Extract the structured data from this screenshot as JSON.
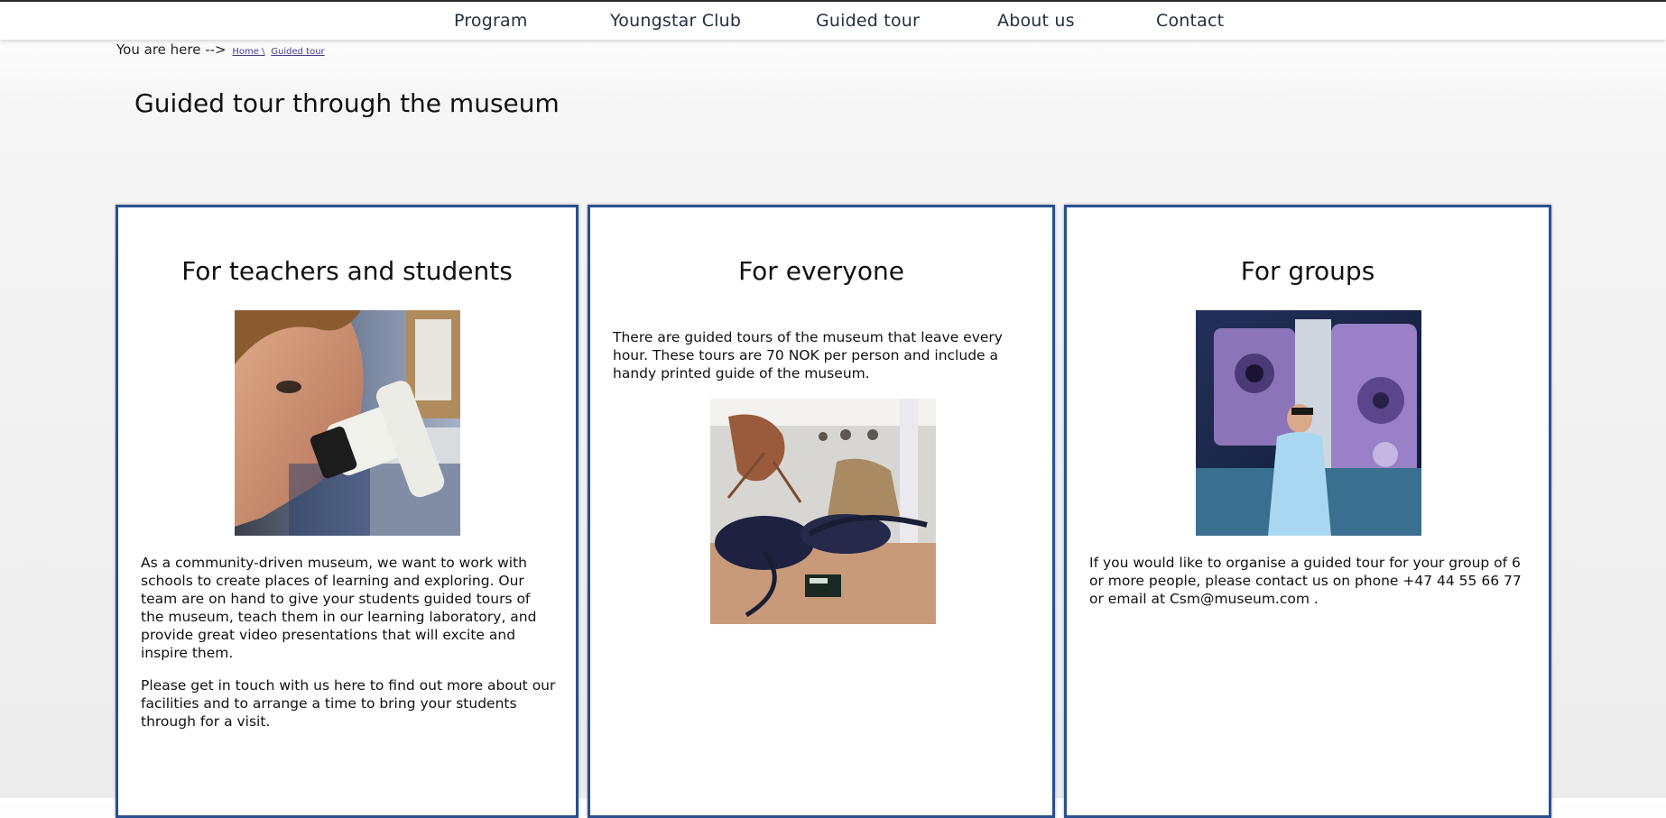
{
  "nav": {
    "items": [
      "Program",
      "Youngstar Club",
      "Guided tour",
      "About us",
      "Contact"
    ]
  },
  "breadcrumb": {
    "prefix": "You are here -->",
    "home": "Home \\",
    "current": "Guided tour"
  },
  "page": {
    "title": "Guided tour through the museum"
  },
  "cards": [
    {
      "heading": "For teachers and students",
      "paragraph1": "As a community-driven museum, we want to work with schools to create places of learning and exploring. Our team are on hand to give your students guided tours of the museum, teach them in our learning laboratory, and provide great video presentations that will excite and inspire them.",
      "paragraph2": "Please get in touch with us here to find out more about our facilities and to arrange a time to bring your students through for a visit."
    },
    {
      "heading": "For everyone",
      "paragraph1": "There are guided tours of the museum that leave every hour. These tours are 70 NOK per person and include a handy printed guide of the museum."
    },
    {
      "heading": "For groups",
      "paragraph1": "If you would like to organise a guided tour for your group of 6 or more people, please contact us on phone +47 44 55 66 77 or email at Csm@museum.com ."
    }
  ]
}
